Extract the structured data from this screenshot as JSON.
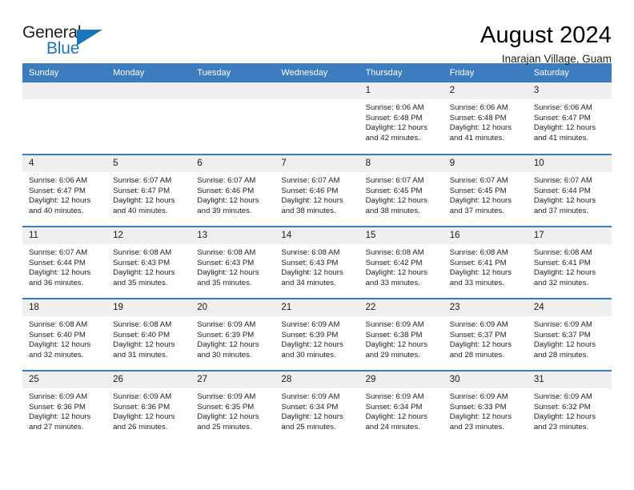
{
  "brand": {
    "name_top": "General",
    "name_bottom": "Blue",
    "triangle_color": "#1b76bc"
  },
  "header": {
    "title": "August 2024",
    "subtitle": "Inarajan Village, Guam"
  },
  "theme": {
    "header_blue": "#3c7cbf",
    "daynum_bg": "#efefef",
    "text": "#222222"
  },
  "calendar": {
    "weekday_headers": [
      "Sunday",
      "Monday",
      "Tuesday",
      "Wednesday",
      "Thursday",
      "Friday",
      "Saturday"
    ],
    "labels": {
      "sunrise": "Sunrise:",
      "sunset": "Sunset:",
      "daylight": "Daylight:"
    },
    "weeks": [
      [
        {
          "day": "",
          "empty": true
        },
        {
          "day": "",
          "empty": true
        },
        {
          "day": "",
          "empty": true
        },
        {
          "day": "",
          "empty": true
        },
        {
          "day": "1",
          "sunrise": "Sunrise: 6:06 AM",
          "sunset": "Sunset: 6:48 PM",
          "daylight1": "Daylight: 12 hours",
          "daylight2": "and 42 minutes."
        },
        {
          "day": "2",
          "sunrise": "Sunrise: 6:06 AM",
          "sunset": "Sunset: 6:48 PM",
          "daylight1": "Daylight: 12 hours",
          "daylight2": "and 41 minutes."
        },
        {
          "day": "3",
          "sunrise": "Sunrise: 6:06 AM",
          "sunset": "Sunset: 6:47 PM",
          "daylight1": "Daylight: 12 hours",
          "daylight2": "and 41 minutes."
        }
      ],
      [
        {
          "day": "4",
          "sunrise": "Sunrise: 6:06 AM",
          "sunset": "Sunset: 6:47 PM",
          "daylight1": "Daylight: 12 hours",
          "daylight2": "and 40 minutes."
        },
        {
          "day": "5",
          "sunrise": "Sunrise: 6:07 AM",
          "sunset": "Sunset: 6:47 PM",
          "daylight1": "Daylight: 12 hours",
          "daylight2": "and 40 minutes."
        },
        {
          "day": "6",
          "sunrise": "Sunrise: 6:07 AM",
          "sunset": "Sunset: 6:46 PM",
          "daylight1": "Daylight: 12 hours",
          "daylight2": "and 39 minutes."
        },
        {
          "day": "7",
          "sunrise": "Sunrise: 6:07 AM",
          "sunset": "Sunset: 6:46 PM",
          "daylight1": "Daylight: 12 hours",
          "daylight2": "and 38 minutes."
        },
        {
          "day": "8",
          "sunrise": "Sunrise: 6:07 AM",
          "sunset": "Sunset: 6:45 PM",
          "daylight1": "Daylight: 12 hours",
          "daylight2": "and 38 minutes."
        },
        {
          "day": "9",
          "sunrise": "Sunrise: 6:07 AM",
          "sunset": "Sunset: 6:45 PM",
          "daylight1": "Daylight: 12 hours",
          "daylight2": "and 37 minutes."
        },
        {
          "day": "10",
          "sunrise": "Sunrise: 6:07 AM",
          "sunset": "Sunset: 6:44 PM",
          "daylight1": "Daylight: 12 hours",
          "daylight2": "and 37 minutes."
        }
      ],
      [
        {
          "day": "11",
          "sunrise": "Sunrise: 6:07 AM",
          "sunset": "Sunset: 6:44 PM",
          "daylight1": "Daylight: 12 hours",
          "daylight2": "and 36 minutes."
        },
        {
          "day": "12",
          "sunrise": "Sunrise: 6:08 AM",
          "sunset": "Sunset: 6:43 PM",
          "daylight1": "Daylight: 12 hours",
          "daylight2": "and 35 minutes."
        },
        {
          "day": "13",
          "sunrise": "Sunrise: 6:08 AM",
          "sunset": "Sunset: 6:43 PM",
          "daylight1": "Daylight: 12 hours",
          "daylight2": "and 35 minutes."
        },
        {
          "day": "14",
          "sunrise": "Sunrise: 6:08 AM",
          "sunset": "Sunset: 6:43 PM",
          "daylight1": "Daylight: 12 hours",
          "daylight2": "and 34 minutes."
        },
        {
          "day": "15",
          "sunrise": "Sunrise: 6:08 AM",
          "sunset": "Sunset: 6:42 PM",
          "daylight1": "Daylight: 12 hours",
          "daylight2": "and 33 minutes."
        },
        {
          "day": "16",
          "sunrise": "Sunrise: 6:08 AM",
          "sunset": "Sunset: 6:41 PM",
          "daylight1": "Daylight: 12 hours",
          "daylight2": "and 33 minutes."
        },
        {
          "day": "17",
          "sunrise": "Sunrise: 6:08 AM",
          "sunset": "Sunset: 6:41 PM",
          "daylight1": "Daylight: 12 hours",
          "daylight2": "and 32 minutes."
        }
      ],
      [
        {
          "day": "18",
          "sunrise": "Sunrise: 6:08 AM",
          "sunset": "Sunset: 6:40 PM",
          "daylight1": "Daylight: 12 hours",
          "daylight2": "and 32 minutes."
        },
        {
          "day": "19",
          "sunrise": "Sunrise: 6:08 AM",
          "sunset": "Sunset: 6:40 PM",
          "daylight1": "Daylight: 12 hours",
          "daylight2": "and 31 minutes."
        },
        {
          "day": "20",
          "sunrise": "Sunrise: 6:09 AM",
          "sunset": "Sunset: 6:39 PM",
          "daylight1": "Daylight: 12 hours",
          "daylight2": "and 30 minutes."
        },
        {
          "day": "21",
          "sunrise": "Sunrise: 6:09 AM",
          "sunset": "Sunset: 6:39 PM",
          "daylight1": "Daylight: 12 hours",
          "daylight2": "and 30 minutes."
        },
        {
          "day": "22",
          "sunrise": "Sunrise: 6:09 AM",
          "sunset": "Sunset: 6:38 PM",
          "daylight1": "Daylight: 12 hours",
          "daylight2": "and 29 minutes."
        },
        {
          "day": "23",
          "sunrise": "Sunrise: 6:09 AM",
          "sunset": "Sunset: 6:37 PM",
          "daylight1": "Daylight: 12 hours",
          "daylight2": "and 28 minutes."
        },
        {
          "day": "24",
          "sunrise": "Sunrise: 6:09 AM",
          "sunset": "Sunset: 6:37 PM",
          "daylight1": "Daylight: 12 hours",
          "daylight2": "and 28 minutes."
        }
      ],
      [
        {
          "day": "25",
          "sunrise": "Sunrise: 6:09 AM",
          "sunset": "Sunset: 6:36 PM",
          "daylight1": "Daylight: 12 hours",
          "daylight2": "and 27 minutes."
        },
        {
          "day": "26",
          "sunrise": "Sunrise: 6:09 AM",
          "sunset": "Sunset: 6:36 PM",
          "daylight1": "Daylight: 12 hours",
          "daylight2": "and 26 minutes."
        },
        {
          "day": "27",
          "sunrise": "Sunrise: 6:09 AM",
          "sunset": "Sunset: 6:35 PM",
          "daylight1": "Daylight: 12 hours",
          "daylight2": "and 25 minutes."
        },
        {
          "day": "28",
          "sunrise": "Sunrise: 6:09 AM",
          "sunset": "Sunset: 6:34 PM",
          "daylight1": "Daylight: 12 hours",
          "daylight2": "and 25 minutes."
        },
        {
          "day": "29",
          "sunrise": "Sunrise: 6:09 AM",
          "sunset": "Sunset: 6:34 PM",
          "daylight1": "Daylight: 12 hours",
          "daylight2": "and 24 minutes."
        },
        {
          "day": "30",
          "sunrise": "Sunrise: 6:09 AM",
          "sunset": "Sunset: 6:33 PM",
          "daylight1": "Daylight: 12 hours",
          "daylight2": "and 23 minutes."
        },
        {
          "day": "31",
          "sunrise": "Sunrise: 6:09 AM",
          "sunset": "Sunset: 6:32 PM",
          "daylight1": "Daylight: 12 hours",
          "daylight2": "and 23 minutes."
        }
      ]
    ]
  }
}
